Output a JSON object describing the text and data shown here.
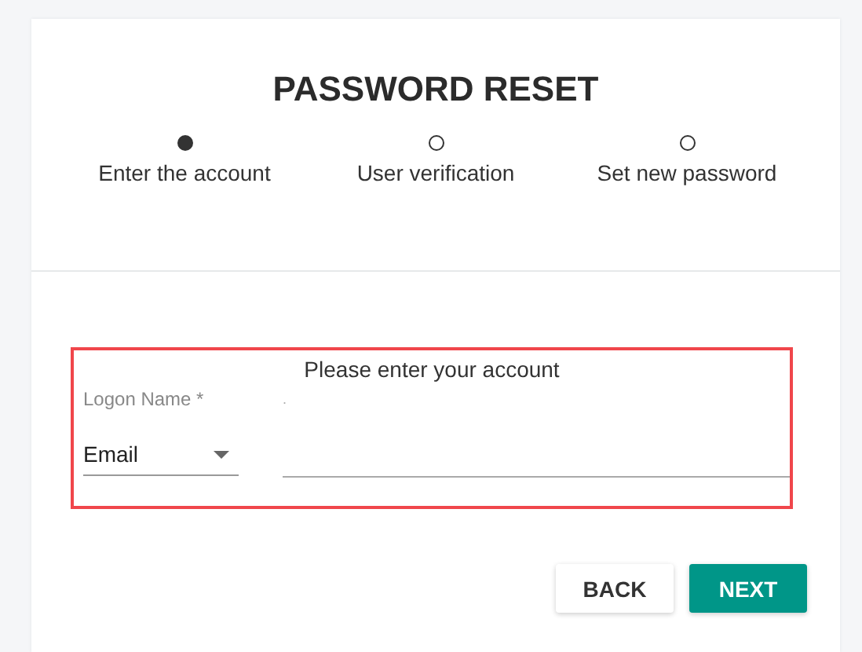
{
  "title": "PASSWORD RESET",
  "steps": [
    {
      "label": "Enter the account",
      "selected": true
    },
    {
      "label": "User verification",
      "selected": false
    },
    {
      "label": "Set new password",
      "selected": false
    }
  ],
  "form": {
    "heading": "Please enter your account",
    "label": "Logon Name *",
    "type_select": {
      "value": "Email"
    },
    "input_hint": "."
  },
  "buttons": [
    {
      "label": "BACK",
      "kind": "secondary"
    },
    {
      "label": "NEXT",
      "kind": "primary"
    }
  ]
}
